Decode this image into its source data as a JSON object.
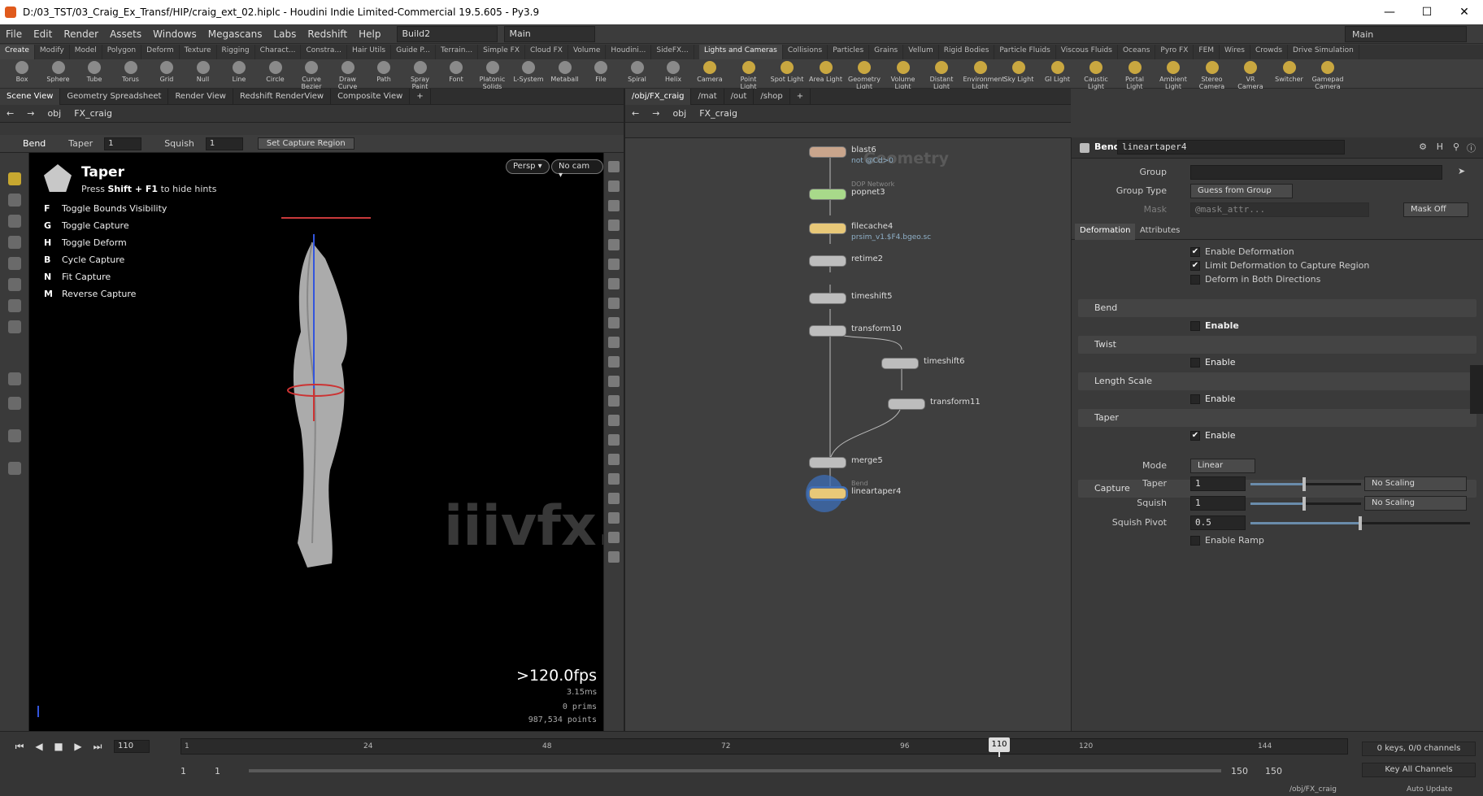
{
  "window": {
    "title": "D:/03_TST/03_Craig_Ex_Transf/HIP/craig_ext_02.hiplc - Houdini Indie Limited-Commercial 19.5.605 - Py3.9",
    "controls": [
      "—",
      "☐",
      "✕"
    ]
  },
  "menubar": {
    "items": [
      "File",
      "Edit",
      "Render",
      "Assets",
      "Windows",
      "Megascans",
      "Labs",
      "Redshift",
      "Help"
    ],
    "desktop": "Build2",
    "desktop2": "Main",
    "main_selector": "Main"
  },
  "shelf_tabs_left": [
    "Create",
    "Modify",
    "Model",
    "Polygon",
    "Deform",
    "Texture",
    "Rigging",
    "Charact...",
    "Constra...",
    "Hair Utils",
    "Guide P...",
    "Terrain...",
    "Simple FX",
    "Cloud FX",
    "Volume",
    "Houdini...",
    "SideFX..."
  ],
  "shelf_tabs_right": [
    "Lights and Cameras",
    "Collisions",
    "Particles",
    "Grains",
    "Vellum",
    "Rigid Bodies",
    "Particle Fluids",
    "Viscous Fluids",
    "Oceans",
    "Pyro FX",
    "FEM",
    "Wires",
    "Crowds",
    "Drive Simulation"
  ],
  "shelf_tools_left": [
    "Box",
    "Sphere",
    "Tube",
    "Torus",
    "Grid",
    "Null",
    "Line",
    "Circle",
    "Curve Bezier",
    "Draw Curve",
    "Path",
    "Spray Paint",
    "Font",
    "Platonic Solids",
    "L-System",
    "Metaball",
    "File",
    "Spiral",
    "Helix"
  ],
  "shelf_tools_right": [
    "Camera",
    "Point Light",
    "Spot Light",
    "Area Light",
    "Geometry Light",
    "Volume Light",
    "Distant Light",
    "Environment Light",
    "Sky Light",
    "GI Light",
    "Caustic Light",
    "Portal Light",
    "Ambient Light",
    "Stereo Camera",
    "VR Camera",
    "Switcher",
    "Gamepad Camera"
  ],
  "left_panel": {
    "tabs": [
      "Scene View",
      "Geometry Spreadsheet",
      "Render View",
      "Redshift RenderView",
      "Composite View"
    ],
    "path": [
      "obj",
      "FX_craig"
    ],
    "tool_options": {
      "tool": "Bend",
      "taper_label": "Taper",
      "taper_value": "1",
      "squish_label": "Squish",
      "squish_value": "1",
      "button": "Set Capture Region"
    },
    "viewport": {
      "hint_title": "Taper",
      "hint_sub_pre": "Press ",
      "hint_sub_key": "Shift + F1",
      "hint_sub_post": " to hide hints",
      "hints": [
        {
          "key": "F",
          "text": "Toggle Bounds Visibility"
        },
        {
          "key": "G",
          "text": "Toggle Capture"
        },
        {
          "key": "H",
          "text": "Toggle Deform"
        },
        {
          "key": "B",
          "text": "Cycle Capture"
        },
        {
          "key": "N",
          "text": "Fit Capture"
        },
        {
          "key": "M",
          "text": "Reverse Capture"
        }
      ],
      "persp": "Persp ▾",
      "cam": "No cam ▾",
      "fps": ">120.0fps",
      "ms": "3.15ms",
      "prims_label": "0  prims",
      "points_label": "987,534 points",
      "watermark": "iiivfx.com"
    }
  },
  "network_panel": {
    "tabs": [
      "/obj/FX_craig",
      "/mat",
      "/out",
      "/shop"
    ],
    "path": [
      "obj",
      "FX_craig"
    ],
    "context_label": "Geometry",
    "nodes": [
      {
        "name": "blast6",
        "sub": "not @Cd>0",
        "color": "#c9a58c"
      },
      {
        "name": "popnet3",
        "sub": "",
        "color": "#a8d98a",
        "pre": "DOP Network"
      },
      {
        "name": "filecache4",
        "sub": "prsim_v1.$F4.bgeo.sc",
        "color": "#e8c878"
      },
      {
        "name": "retime2",
        "sub": "",
        "color": "#bdbdbd"
      },
      {
        "name": "timeshift5",
        "sub": "",
        "color": "#bdbdbd"
      },
      {
        "name": "transform10",
        "sub": "",
        "color": "#bdbdbd"
      },
      {
        "name": "timeshift6",
        "sub": "",
        "color": "#bdbdbd"
      },
      {
        "name": "transform11",
        "sub": "",
        "color": "#bdbdbd"
      },
      {
        "name": "merge5",
        "sub": "",
        "color": "#bdbdbd"
      },
      {
        "name": "lineartaper4",
        "sub": "",
        "color": "#e8c878",
        "pre": "Bend"
      }
    ]
  },
  "parm_panel": {
    "node_type": "Bend",
    "node_name": "lineartaper4",
    "group_label": "Group",
    "group_value": "",
    "group_type_label": "Group Type",
    "group_type_value": "Guess from Group",
    "mask_label": "Mask",
    "mask_value": "@mask_attr...",
    "mask_off": "Mask Off",
    "tabs": [
      "Deformation",
      "Attributes"
    ],
    "checks": [
      {
        "label": "Enable Deformation",
        "checked": true
      },
      {
        "label": "Limit Deformation to Capture Region",
        "checked": true
      },
      {
        "label": "Deform in Both Directions",
        "checked": false
      }
    ],
    "sections": [
      "Bend",
      "Twist",
      "Length Scale",
      "Taper",
      "Capture"
    ],
    "enable_label": "Enable",
    "mode_label": "Mode",
    "mode_value": "Linear",
    "taper_label": "Taper",
    "taper_value": "1",
    "taper_scaling": "No Scaling",
    "squish_label": "Squish",
    "squish_value": "1",
    "squish_scaling": "No Scaling",
    "pivot_label": "Squish Pivot",
    "pivot_value": "0.5",
    "ramp_label": "Enable Ramp"
  },
  "timeline": {
    "frame": "110",
    "frame_marker": "110",
    "ticks": [
      "1",
      "24",
      "48",
      "72",
      "96",
      "120",
      "144"
    ],
    "start": "1",
    "start2": "1",
    "end": "150",
    "end2": "150",
    "keys": "0 keys, 0/0 channels",
    "key_all": "Key All Channels",
    "status_path": "/obj/FX_craig",
    "auto_update": "Auto Update"
  },
  "colors": {
    "accent": "#6a8cab",
    "node_bend": "#e8c878",
    "node_dop": "#a8d98a",
    "node_display_ring": "#3e6fb8"
  }
}
